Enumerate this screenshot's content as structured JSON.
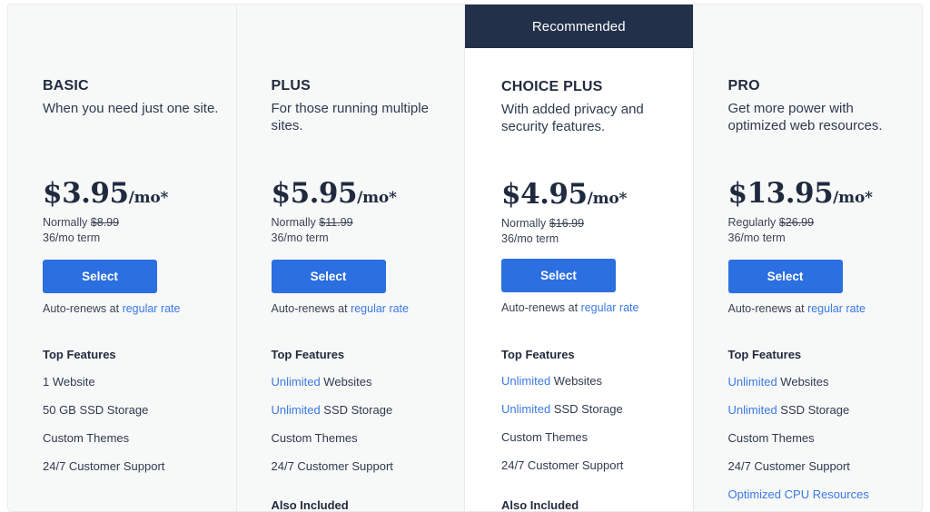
{
  "colors": {
    "accent_blue": "#2b6fe0",
    "link_blue": "#3b7ae4",
    "banner_navy": "#22304a",
    "card_bg": "#f7f8f8",
    "featured_bg": "#ffffff",
    "text_dark": "#222b3e"
  },
  "plans": [
    {
      "name": "BASIC",
      "description": "When you need just one site.",
      "featured": false,
      "banner_label": "",
      "price_amount": "$3.95",
      "price_period": "/mo*",
      "normally_label": "Normally",
      "normally_price": "$8.99",
      "term": "36/mo term",
      "select_label": "Select",
      "renew_prefix": "Auto-renews at",
      "renew_link": "regular rate",
      "features_title": "Top Features",
      "features": [
        {
          "highlight": "",
          "text": "1 Website",
          "all_blue": false
        },
        {
          "highlight": "",
          "text": "50 GB SSD Storage",
          "all_blue": false
        },
        {
          "highlight": "",
          "text": "Custom Themes",
          "all_blue": false
        },
        {
          "highlight": "",
          "text": "24/7 Customer Support",
          "all_blue": false
        }
      ],
      "also_included": ""
    },
    {
      "name": "PLUS",
      "description": "For those running multiple sites.",
      "featured": false,
      "banner_label": "",
      "price_amount": "$5.95",
      "price_period": "/mo*",
      "normally_label": "Normally",
      "normally_price": "$11.99",
      "term": "36/mo term",
      "select_label": "Select",
      "renew_prefix": "Auto-renews at",
      "renew_link": "regular rate",
      "features_title": "Top Features",
      "features": [
        {
          "highlight": "Unlimited",
          "text": " Websites",
          "all_blue": false
        },
        {
          "highlight": "Unlimited",
          "text": " SSD Storage",
          "all_blue": false
        },
        {
          "highlight": "",
          "text": "Custom Themes",
          "all_blue": false
        },
        {
          "highlight": "",
          "text": "24/7 Customer Support",
          "all_blue": false
        }
      ],
      "also_included": "Also Included"
    },
    {
      "name": "CHOICE PLUS",
      "description": "With added privacy and security features.",
      "featured": true,
      "banner_label": "Recommended",
      "price_amount": "$4.95",
      "price_period": "/mo*",
      "normally_label": "Normally",
      "normally_price": "$16.99",
      "term": "36/mo term",
      "select_label": "Select",
      "renew_prefix": "Auto-renews at",
      "renew_link": "regular rate",
      "features_title": "Top Features",
      "features": [
        {
          "highlight": "Unlimited",
          "text": " Websites",
          "all_blue": false
        },
        {
          "highlight": "Unlimited",
          "text": " SSD Storage",
          "all_blue": false
        },
        {
          "highlight": "",
          "text": "Custom Themes",
          "all_blue": false
        },
        {
          "highlight": "",
          "text": "24/7 Customer Support",
          "all_blue": false
        }
      ],
      "also_included": "Also Included"
    },
    {
      "name": "PRO",
      "description": "Get more power with optimized web resources.",
      "featured": false,
      "banner_label": "",
      "price_amount": "$13.95",
      "price_period": "/mo*",
      "normally_label": "Regularly",
      "normally_price": "$26.99",
      "term": "36/mo term",
      "select_label": "Select",
      "renew_prefix": "Auto-renews at",
      "renew_link": "regular rate",
      "features_title": "Top Features",
      "features": [
        {
          "highlight": "Unlimited",
          "text": " Websites",
          "all_blue": false
        },
        {
          "highlight": "Unlimited",
          "text": " SSD Storage",
          "all_blue": false
        },
        {
          "highlight": "",
          "text": "Custom Themes",
          "all_blue": false
        },
        {
          "highlight": "",
          "text": "24/7 Customer Support",
          "all_blue": false
        },
        {
          "highlight": "",
          "text": "Optimized CPU Resources",
          "all_blue": true
        }
      ],
      "also_included": ""
    }
  ]
}
